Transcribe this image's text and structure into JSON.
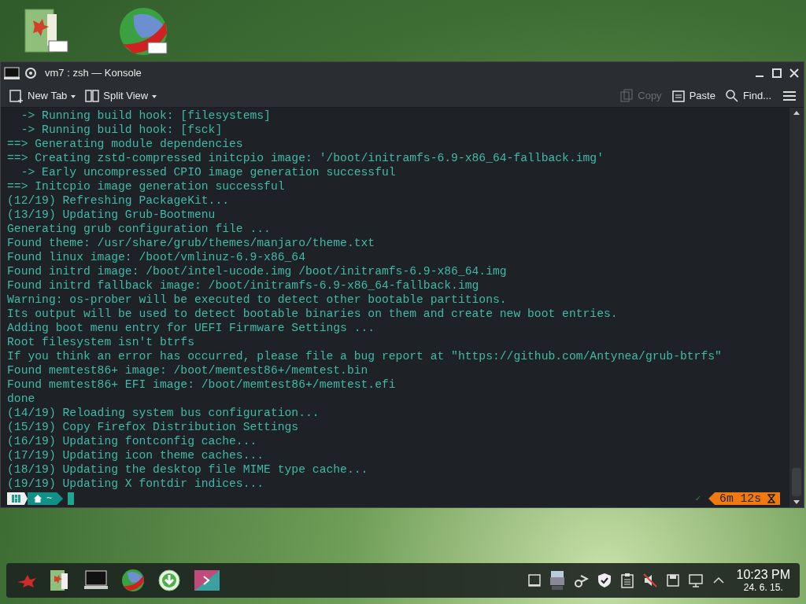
{
  "window": {
    "title": "vm7 : zsh — Konsole"
  },
  "toolbar": {
    "left": [
      {
        "label": "New Tab",
        "kind": "newtab",
        "disabled": false
      },
      {
        "label": "Split View",
        "kind": "split",
        "disabled": false
      }
    ],
    "right": [
      {
        "label": "Copy",
        "kind": "copy",
        "disabled": true
      },
      {
        "label": "Paste",
        "kind": "paste",
        "disabled": false
      },
      {
        "label": "Find...",
        "kind": "find",
        "disabled": false
      }
    ]
  },
  "terminal": {
    "lines": [
      "  -> Running build hook: [filesystems]",
      "  -> Running build hook: [fsck]",
      "==> Generating module dependencies",
      "==> Creating zstd-compressed initcpio image: '/boot/initramfs-6.9-x86_64-fallback.img'",
      "  -> Early uncompressed CPIO image generation successful",
      "==> Initcpio image generation successful",
      "(12/19) Refreshing PackageKit...",
      "(13/19) Updating Grub-Bootmenu",
      "Generating grub configuration file ...",
      "Found theme: /usr/share/grub/themes/manjaro/theme.txt",
      "Found linux image: /boot/vmlinuz-6.9-x86_64",
      "Found initrd image: /boot/intel-ucode.img /boot/initramfs-6.9-x86_64.img",
      "Found initrd fallback image: /boot/initramfs-6.9-x86_64-fallback.img",
      "Warning: os-prober will be executed to detect other bootable partitions.",
      "Its output will be used to detect bootable binaries on them and create new boot entries.",
      "Adding boot menu entry for UEFI Firmware Settings ...",
      "Root filesystem isn't btrfs",
      "If you think an error has occurred, please file a bug report at \"https://github.com/Antynea/grub-btrfs\"",
      "Found memtest86+ image: /boot/memtest86+/memtest.bin",
      "Found memtest86+ EFI image: /boot/memtest86+/memtest.efi",
      "done",
      "(14/19) Reloading system bus configuration...",
      "(15/19) Copy Firefox Distribution Settings",
      "(16/19) Updating fontconfig cache...",
      "(17/19) Updating icon theme caches...",
      "(18/19) Updating the desktop file MIME type cache...",
      "(19/19) Updating X fontdir indices..."
    ],
    "prompt": {
      "path": "~",
      "status_mark": "✓",
      "duration": "6m 12s"
    }
  },
  "taskbar": {
    "clock_time": "10:23 PM",
    "clock_date": "24. 6. 15."
  }
}
